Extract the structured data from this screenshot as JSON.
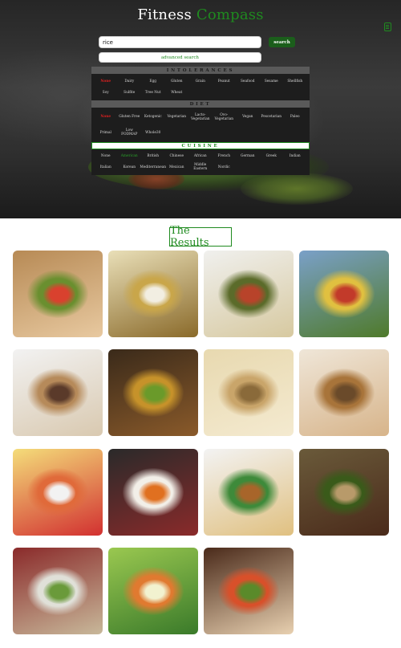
{
  "header": {
    "title_main": "Fitness",
    "title_accent": "Compass",
    "mobile_icon": "mobile-phone-icon"
  },
  "search": {
    "value": "rice",
    "button_label": "search",
    "advanced_label": "advanced search"
  },
  "filters": {
    "intolerances": {
      "heading": "INTOLERANCES",
      "items": [
        "None",
        "Dairy",
        "Egg",
        "Gluten",
        "Grain",
        "Peanut",
        "Seafood",
        "Sesame",
        "Shellfish",
        "Soy",
        "Sulfite",
        "Tree Nut",
        "Wheat"
      ],
      "selected": "None"
    },
    "diet": {
      "heading": "DIET",
      "items": [
        "None",
        "Gluten Free",
        "Ketogenic",
        "Vegetarian",
        "Lacto-Vegetarian",
        "Ovo-Vegetarian",
        "Vegan",
        "Pescetarian",
        "Paleo",
        "Primal",
        "Low FODMAP",
        "Whole30"
      ],
      "selected": "None"
    },
    "cuisine": {
      "heading": "CUISINE",
      "items": [
        "None",
        "American",
        "British",
        "Chinese",
        "African",
        "French",
        "German",
        "Greek",
        "Indian",
        "Italian",
        "Korean",
        "Mediterranean",
        "Mexican",
        "Middle Eastern",
        "Nordic"
      ],
      "selected": "American"
    }
  },
  "results": {
    "title": "The Results"
  },
  "colors": {
    "accent_green": "#1f8a1f",
    "selected_red": "#e02020",
    "search_button": "#1b5e1b"
  }
}
